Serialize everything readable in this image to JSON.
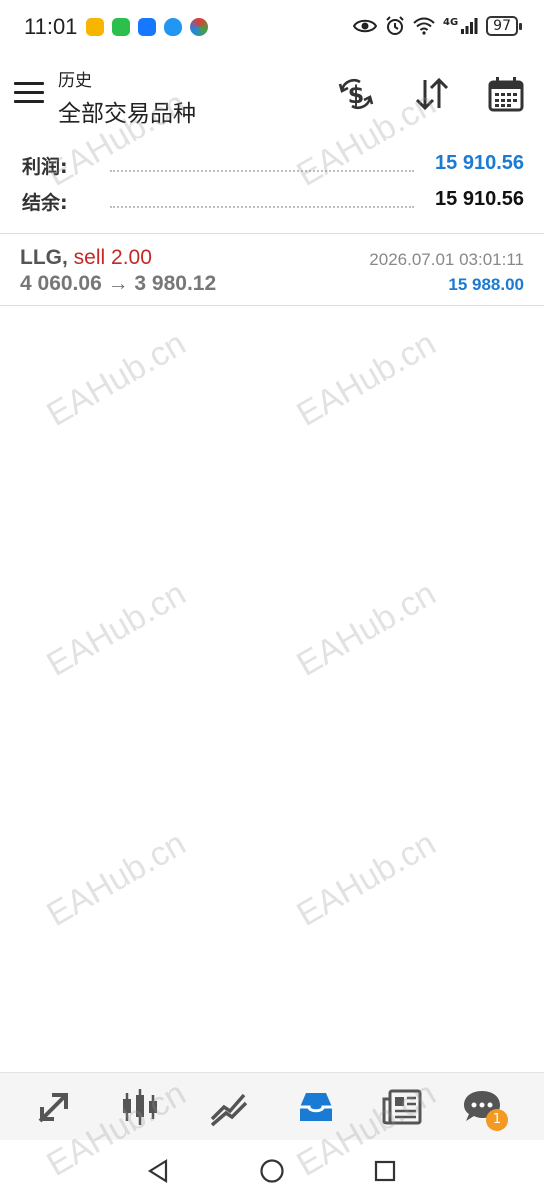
{
  "status_bar": {
    "time": "11:01",
    "battery": "97",
    "network": "4G"
  },
  "toolbar": {
    "subtitle": "历史",
    "title": "全部交易品种",
    "icons": [
      "currency-exchange-icon",
      "sort-icon",
      "calendar-icon"
    ]
  },
  "summary": {
    "profit_label": "利润:",
    "profit_value": "15 910.56",
    "balance_label": "结余:",
    "balance_value": "15 910.56"
  },
  "deals": [
    {
      "symbol": "LLG,",
      "side": "sell 2.00",
      "prices": "4 060.06 → 3 980.12",
      "time": "2026.07.01 03:01:11",
      "profit": "15 988.00"
    }
  ],
  "watermark": "EAHub.cn",
  "bottom_nav": {
    "items": [
      "trade-arrows-icon",
      "candlestick-icon",
      "chart-lines-icon",
      "history-inbox-icon",
      "news-icon",
      "chat-icon"
    ],
    "active": "history-inbox-icon",
    "chat_badge": "1"
  },
  "colors": {
    "accent_blue": "#1a7bd4",
    "sell_red": "#c62828",
    "badge_orange": "#f29a21"
  }
}
